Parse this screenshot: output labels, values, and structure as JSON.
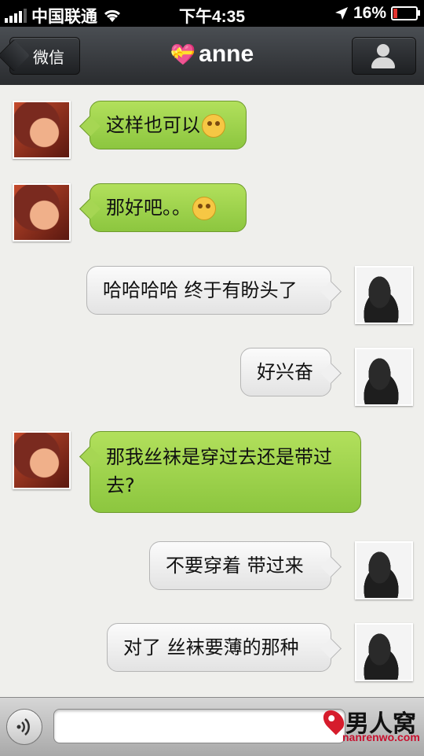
{
  "status": {
    "carrier": "中国联通",
    "time": "下午4:35",
    "battery": "16%",
    "battery_level": 0.16
  },
  "nav": {
    "back_label": "微信",
    "title": "anne"
  },
  "messages": [
    {
      "from": "anne",
      "text": "这样也可以",
      "emoji": "dizzy-face"
    },
    {
      "from": "anne",
      "text": "那好吧。。",
      "emoji": "smiling-face"
    },
    {
      "from": "me",
      "text": "哈哈哈哈 终于有盼头了"
    },
    {
      "from": "me",
      "text": "好兴奋"
    },
    {
      "from": "anne",
      "text": "那我丝袜是穿过去还是带过去?"
    },
    {
      "from": "me",
      "text": "不要穿着 带过来"
    },
    {
      "from": "me",
      "text": "对了 丝袜要薄的那种"
    }
  ],
  "input": {
    "value": "",
    "placeholder": ""
  },
  "watermark": {
    "main": "男人窝",
    "sub": "nanrenwo.com",
    "prefix": "b"
  },
  "colors": {
    "incoming_bubble": "#9ed14c",
    "outgoing_bubble": "#efefef",
    "battery_low": "#e3342f"
  }
}
